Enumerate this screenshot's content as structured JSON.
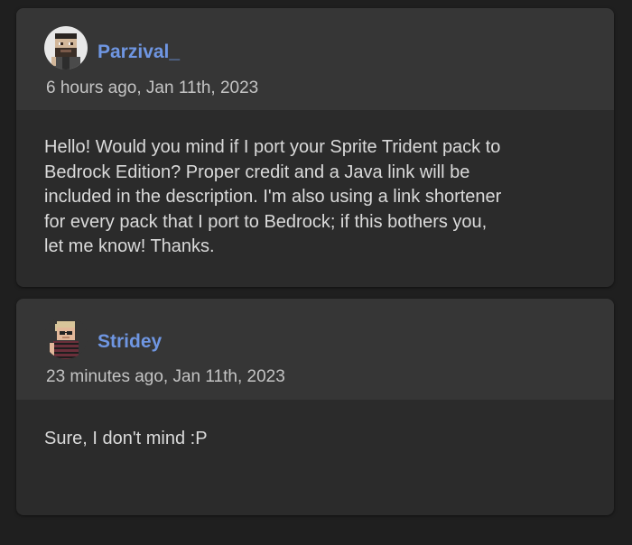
{
  "comments": [
    {
      "username": "Parzival_",
      "timestamp": "6 hours ago, Jan 11th, 2023",
      "avatar": "parzival-avatar-icon",
      "lines": [
        "Hello! Would you mind if I port your Sprite Trident pack to",
        "Bedrock Edition? Proper credit and a Java link will be",
        "included in the description. I'm also using a link shortener",
        "for every pack that I port to Bedrock; if this bothers you,",
        "let me know! Thanks."
      ]
    },
    {
      "username": "Stridey",
      "timestamp": "23 minutes ago, Jan 11th, 2023",
      "avatar": "stridey-avatar-icon",
      "lines": [
        "Sure, I don't mind :P"
      ]
    }
  ],
  "colors": {
    "page_bg": "#1f1f1f",
    "card_bg": "#2b2b2b",
    "header_bg": "#363636",
    "username": "#6f96e2",
    "timestamp": "#c4c4c4",
    "body_text": "#dadada"
  }
}
